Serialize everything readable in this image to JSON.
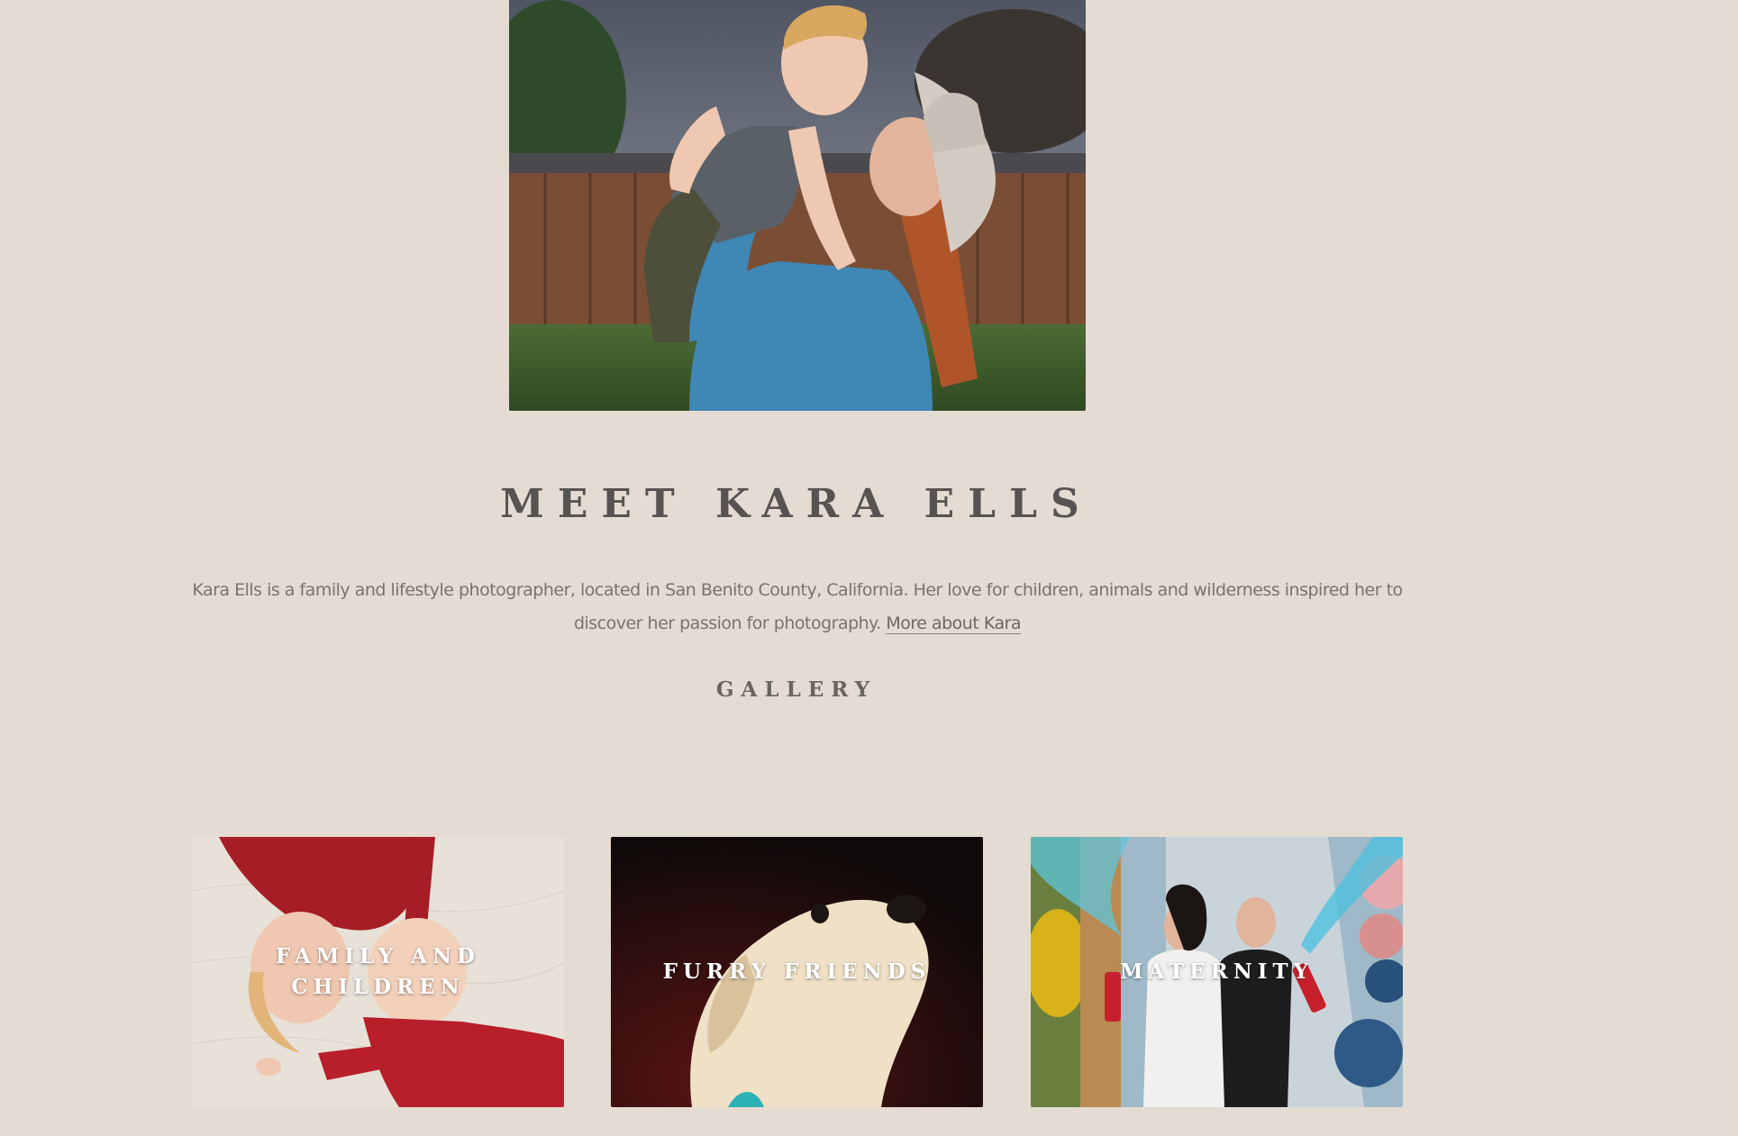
{
  "hero": {
    "alt": "Kara lifting her son in the backyard"
  },
  "about": {
    "title": "MEET KARA ELLS",
    "bio_text": "Kara Ells is a family and lifestyle photographer, located in San Benito County, California. Her love for children, animals and wilderness inspired her to discover her passion for photography.",
    "more_link": "More about Kara"
  },
  "gallery": {
    "heading": "GALLERY",
    "items": [
      {
        "label": "FAMILY AND CHILDREN"
      },
      {
        "label": "FURRY FRIENDS"
      },
      {
        "label": "MATERNITY"
      }
    ]
  },
  "colors": {
    "page_background": "#e4dbd2",
    "heading_text": "#575350",
    "body_text": "#7a736d"
  }
}
